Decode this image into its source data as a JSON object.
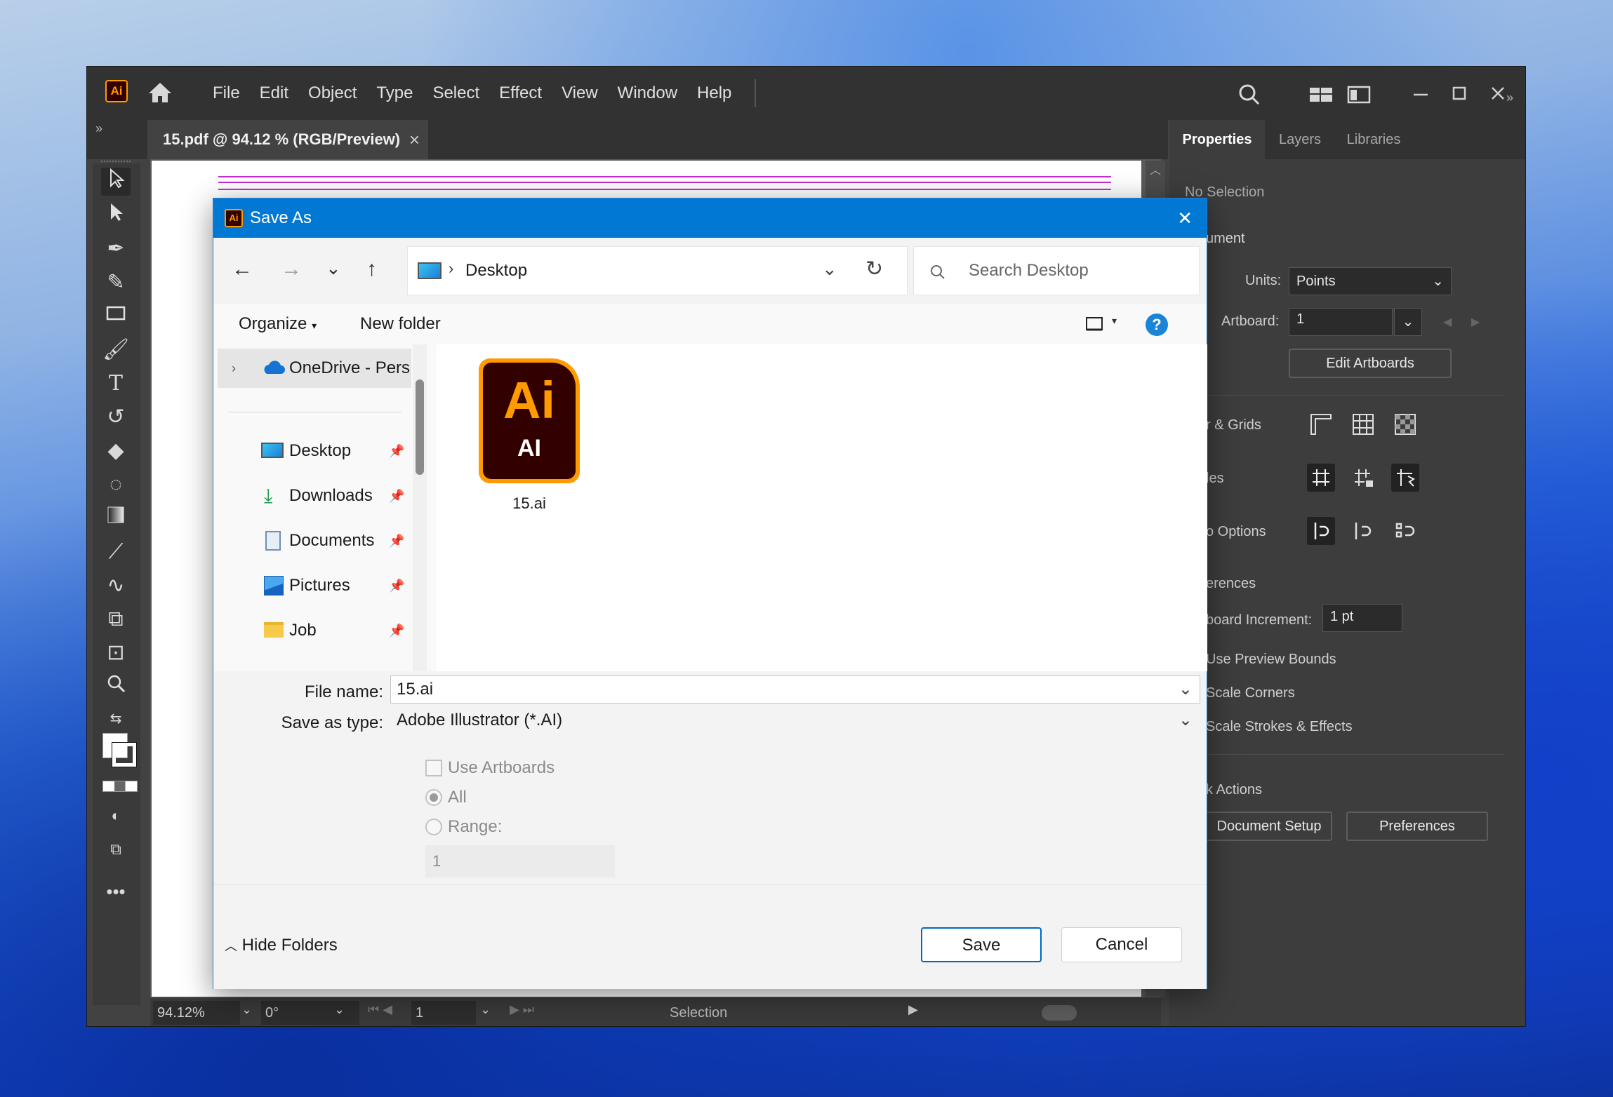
{
  "app": {
    "logo": "Ai",
    "menu": [
      "File",
      "Edit",
      "Object",
      "Type",
      "Select",
      "Effect",
      "View",
      "Window",
      "Help"
    ],
    "doc_tab": "15.pdf @ 94.12 % (RGB/Preview)",
    "doc_tab_close": "×"
  },
  "panel": {
    "tabs": [
      "Properties",
      "Layers",
      "Libraries"
    ],
    "no_selection": "No Selection",
    "document": "ument",
    "units_label": "Units:",
    "units_value": "Points",
    "artboard_label": "Artboard:",
    "artboard_value": "1",
    "edit_artboards": "Edit Artboards",
    "rulers_grids": "r & Grids",
    "guides": "les",
    "snap_options": "o Options",
    "preferences_section": "erences",
    "keyboard_increment_label": "board Increment:",
    "keyboard_increment_value": "1 pt",
    "use_preview_bounds": "Use Preview Bounds",
    "scale_corners": "Scale Corners",
    "scale_strokes": "Scale Strokes & Effects",
    "quick_actions": "k Actions",
    "document_setup": "Document Setup",
    "preferences_btn": "Preferences"
  },
  "status": {
    "zoom": "94.12%",
    "rotation": "0°",
    "artboard": "1",
    "tool": "Selection"
  },
  "dialog": {
    "title": "Save As",
    "close": "✕",
    "address": "Desktop",
    "search_placeholder": "Search Desktop",
    "organize": "Organize",
    "new_folder": "New folder",
    "help": "?",
    "nav_items": [
      {
        "label": "OneDrive - Perso",
        "icon": "onedrive-icon"
      },
      {
        "label": "Desktop",
        "icon": "desktop-icon"
      },
      {
        "label": "Downloads",
        "icon": "download-icon"
      },
      {
        "label": "Documents",
        "icon": "documents-icon"
      },
      {
        "label": "Pictures",
        "icon": "pictures-icon"
      },
      {
        "label": "Job",
        "icon": "folder-icon"
      }
    ],
    "file": {
      "name": "15.ai",
      "icon_top": "Ai",
      "icon_bottom": "AI"
    },
    "file_name_label": "File name:",
    "file_name_value": "15.ai",
    "save_type_label": "Save as type:",
    "save_type_value": "Adobe Illustrator (*.AI)",
    "use_artboards": "Use Artboards",
    "all": "All",
    "range": "Range:",
    "range_value": "1",
    "hide_folders": "Hide Folders",
    "save": "Save",
    "cancel": "Cancel"
  }
}
